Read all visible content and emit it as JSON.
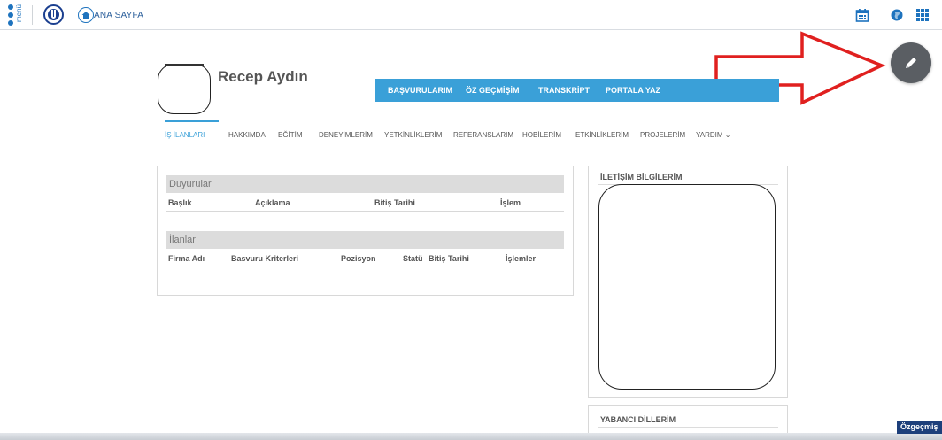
{
  "topbar": {
    "menu_label": "menü",
    "home_label": "ANA SAYFA",
    "icons": [
      "calendar-icon",
      "globe-icon",
      "apps-grid-icon"
    ]
  },
  "profile": {
    "name": "Recep Aydın"
  },
  "profile_tabs": [
    {
      "label": "BAŞVURULARIM"
    },
    {
      "label": "ÖZ GEÇMİŞİM"
    },
    {
      "label": "TRANSKRİPT"
    },
    {
      "label": "PORTALA YAZ"
    }
  ],
  "subnav": [
    {
      "label": "İŞ İLANLARI",
      "active": true
    },
    {
      "label": "HAKKIMDA"
    },
    {
      "label": "EĞİTİM"
    },
    {
      "label": "DENEYİMLERİM"
    },
    {
      "label": "YETKİNLİKLERİM"
    },
    {
      "label": "REFERANSLARIM"
    },
    {
      "label": "HOBİLERİM"
    },
    {
      "label": "ETKİNLİKLERİM"
    },
    {
      "label": "PROJELERİM"
    },
    {
      "label": "YARDIM ⌄"
    }
  ],
  "announcements": {
    "title": "Duyurular",
    "columns": [
      "Başlık",
      "Açıklama",
      "Bitiş Tarihi",
      "İşlem"
    ]
  },
  "listings": {
    "title": "İlanlar",
    "columns": [
      "Firma Adı",
      "Basvuru Kriterleri",
      "Pozisyon",
      "Statü",
      "Bitiş Tarihi",
      "İşlemler"
    ]
  },
  "contact_panel": {
    "title": "İLETİŞİM BİLGİLERİM"
  },
  "languages_panel": {
    "title": "YABANCI DİLLERİM"
  },
  "footer_badge": "Özgeçmiş",
  "colors": {
    "accent": "#3aa0d8",
    "arrow": "#e0201f",
    "fab": "#5a5e63",
    "badge": "#1d3f7b"
  }
}
